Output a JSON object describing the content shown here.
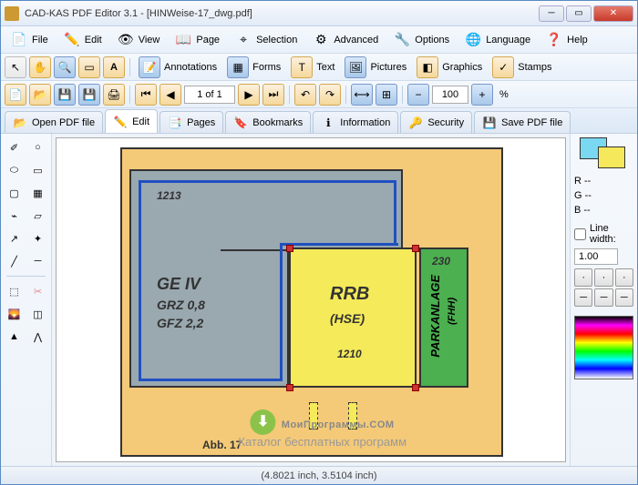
{
  "window": {
    "title": "CAD-KAS PDF Editor 3.1 - [HINWeise-17_dwg.pdf]"
  },
  "menu": {
    "file": "File",
    "edit": "Edit",
    "view": "View",
    "page": "Page",
    "selection": "Selection",
    "advanced": "Advanced",
    "options": "Options",
    "language": "Language",
    "help": "Help"
  },
  "toolbar2": {
    "annotations": "Annotations",
    "forms": "Forms",
    "text": "Text",
    "pictures": "Pictures",
    "graphics": "Graphics",
    "stamps": "Stamps"
  },
  "nav": {
    "page_display": "1 of 1",
    "zoom": "100",
    "zoom_suffix": "%"
  },
  "tabs": {
    "open": "Open PDF file",
    "edit": "Edit",
    "pages": "Pages",
    "bookmarks": "Bookmarks",
    "information": "Information",
    "security": "Security",
    "save": "Save PDF file"
  },
  "right": {
    "r": "R --",
    "g": "G --",
    "b": "B --",
    "line_width_label": "Line width:",
    "line_width": "1.00"
  },
  "drawing": {
    "num_top": "1213",
    "ge": "GE IV",
    "grz": "GRZ 0,8",
    "gfz": "GFZ 2,2",
    "rrb": "RRB",
    "hse": "(HSE)",
    "rrb_num": "1210",
    "park_num": "230",
    "park": "PARKANLAGE",
    "fhh": "(FHH)",
    "abb": "Abb. 17"
  },
  "statusbar": {
    "coords": "(4.8021 inch, 3.5104 inch)"
  },
  "watermark": {
    "title": "МоиПрограммы.COM",
    "subtitle": "Каталог бесплатных программ"
  }
}
